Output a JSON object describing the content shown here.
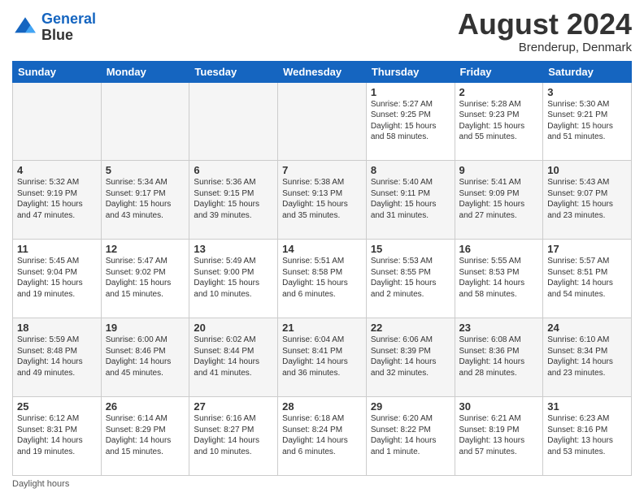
{
  "header": {
    "logo_line1": "General",
    "logo_line2": "Blue",
    "month_title": "August 2024",
    "location": "Brenderup, Denmark"
  },
  "weekdays": [
    "Sunday",
    "Monday",
    "Tuesday",
    "Wednesday",
    "Thursday",
    "Friday",
    "Saturday"
  ],
  "weeks": [
    [
      {
        "day": "",
        "info": "",
        "empty": true
      },
      {
        "day": "",
        "info": "",
        "empty": true
      },
      {
        "day": "",
        "info": "",
        "empty": true
      },
      {
        "day": "",
        "info": "",
        "empty": true
      },
      {
        "day": "1",
        "info": "Sunrise: 5:27 AM\nSunset: 9:25 PM\nDaylight: 15 hours\nand 58 minutes.",
        "empty": false
      },
      {
        "day": "2",
        "info": "Sunrise: 5:28 AM\nSunset: 9:23 PM\nDaylight: 15 hours\nand 55 minutes.",
        "empty": false
      },
      {
        "day": "3",
        "info": "Sunrise: 5:30 AM\nSunset: 9:21 PM\nDaylight: 15 hours\nand 51 minutes.",
        "empty": false
      }
    ],
    [
      {
        "day": "4",
        "info": "Sunrise: 5:32 AM\nSunset: 9:19 PM\nDaylight: 15 hours\nand 47 minutes.",
        "empty": false
      },
      {
        "day": "5",
        "info": "Sunrise: 5:34 AM\nSunset: 9:17 PM\nDaylight: 15 hours\nand 43 minutes.",
        "empty": false
      },
      {
        "day": "6",
        "info": "Sunrise: 5:36 AM\nSunset: 9:15 PM\nDaylight: 15 hours\nand 39 minutes.",
        "empty": false
      },
      {
        "day": "7",
        "info": "Sunrise: 5:38 AM\nSunset: 9:13 PM\nDaylight: 15 hours\nand 35 minutes.",
        "empty": false
      },
      {
        "day": "8",
        "info": "Sunrise: 5:40 AM\nSunset: 9:11 PM\nDaylight: 15 hours\nand 31 minutes.",
        "empty": false
      },
      {
        "day": "9",
        "info": "Sunrise: 5:41 AM\nSunset: 9:09 PM\nDaylight: 15 hours\nand 27 minutes.",
        "empty": false
      },
      {
        "day": "10",
        "info": "Sunrise: 5:43 AM\nSunset: 9:07 PM\nDaylight: 15 hours\nand 23 minutes.",
        "empty": false
      }
    ],
    [
      {
        "day": "11",
        "info": "Sunrise: 5:45 AM\nSunset: 9:04 PM\nDaylight: 15 hours\nand 19 minutes.",
        "empty": false
      },
      {
        "day": "12",
        "info": "Sunrise: 5:47 AM\nSunset: 9:02 PM\nDaylight: 15 hours\nand 15 minutes.",
        "empty": false
      },
      {
        "day": "13",
        "info": "Sunrise: 5:49 AM\nSunset: 9:00 PM\nDaylight: 15 hours\nand 10 minutes.",
        "empty": false
      },
      {
        "day": "14",
        "info": "Sunrise: 5:51 AM\nSunset: 8:58 PM\nDaylight: 15 hours\nand 6 minutes.",
        "empty": false
      },
      {
        "day": "15",
        "info": "Sunrise: 5:53 AM\nSunset: 8:55 PM\nDaylight: 15 hours\nand 2 minutes.",
        "empty": false
      },
      {
        "day": "16",
        "info": "Sunrise: 5:55 AM\nSunset: 8:53 PM\nDaylight: 14 hours\nand 58 minutes.",
        "empty": false
      },
      {
        "day": "17",
        "info": "Sunrise: 5:57 AM\nSunset: 8:51 PM\nDaylight: 14 hours\nand 54 minutes.",
        "empty": false
      }
    ],
    [
      {
        "day": "18",
        "info": "Sunrise: 5:59 AM\nSunset: 8:48 PM\nDaylight: 14 hours\nand 49 minutes.",
        "empty": false
      },
      {
        "day": "19",
        "info": "Sunrise: 6:00 AM\nSunset: 8:46 PM\nDaylight: 14 hours\nand 45 minutes.",
        "empty": false
      },
      {
        "day": "20",
        "info": "Sunrise: 6:02 AM\nSunset: 8:44 PM\nDaylight: 14 hours\nand 41 minutes.",
        "empty": false
      },
      {
        "day": "21",
        "info": "Sunrise: 6:04 AM\nSunset: 8:41 PM\nDaylight: 14 hours\nand 36 minutes.",
        "empty": false
      },
      {
        "day": "22",
        "info": "Sunrise: 6:06 AM\nSunset: 8:39 PM\nDaylight: 14 hours\nand 32 minutes.",
        "empty": false
      },
      {
        "day": "23",
        "info": "Sunrise: 6:08 AM\nSunset: 8:36 PM\nDaylight: 14 hours\nand 28 minutes.",
        "empty": false
      },
      {
        "day": "24",
        "info": "Sunrise: 6:10 AM\nSunset: 8:34 PM\nDaylight: 14 hours\nand 23 minutes.",
        "empty": false
      }
    ],
    [
      {
        "day": "25",
        "info": "Sunrise: 6:12 AM\nSunset: 8:31 PM\nDaylight: 14 hours\nand 19 minutes.",
        "empty": false
      },
      {
        "day": "26",
        "info": "Sunrise: 6:14 AM\nSunset: 8:29 PM\nDaylight: 14 hours\nand 15 minutes.",
        "empty": false
      },
      {
        "day": "27",
        "info": "Sunrise: 6:16 AM\nSunset: 8:27 PM\nDaylight: 14 hours\nand 10 minutes.",
        "empty": false
      },
      {
        "day": "28",
        "info": "Sunrise: 6:18 AM\nSunset: 8:24 PM\nDaylight: 14 hours\nand 6 minutes.",
        "empty": false
      },
      {
        "day": "29",
        "info": "Sunrise: 6:20 AM\nSunset: 8:22 PM\nDaylight: 14 hours\nand 1 minute.",
        "empty": false
      },
      {
        "day": "30",
        "info": "Sunrise: 6:21 AM\nSunset: 8:19 PM\nDaylight: 13 hours\nand 57 minutes.",
        "empty": false
      },
      {
        "day": "31",
        "info": "Sunrise: 6:23 AM\nSunset: 8:16 PM\nDaylight: 13 hours\nand 53 minutes.",
        "empty": false
      }
    ]
  ],
  "footer": {
    "note": "Daylight hours"
  }
}
